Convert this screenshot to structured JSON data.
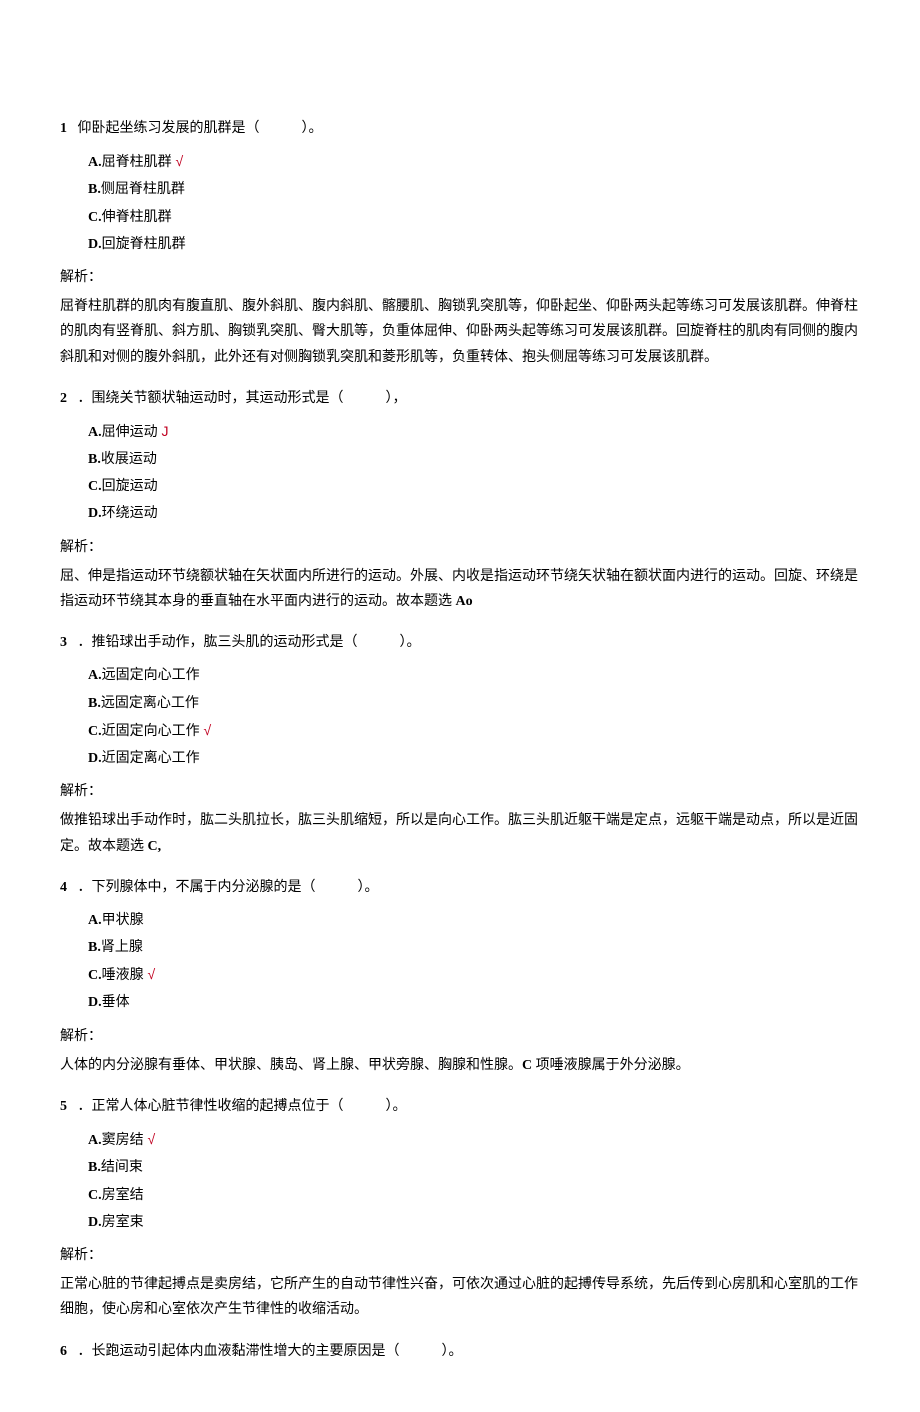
{
  "questions": [
    {
      "num": "1",
      "stem_before": "仰卧起坐练习发展的肌群是（",
      "stem_after": "）。",
      "options": [
        {
          "letter": "A.",
          "text": "屈脊柱肌群",
          "correct": true
        },
        {
          "letter": "B.",
          "text": "侧屈脊柱肌群",
          "correct": false
        },
        {
          "letter": "C.",
          "text": "伸脊柱肌群",
          "correct": false
        },
        {
          "letter": "D.",
          "text": "回旋脊柱肌群",
          "correct": false
        }
      ],
      "jx_label": "解析：",
      "explanation": "屈脊柱肌群的肌肉有腹直肌、腹外斜肌、腹内斜肌、髂腰肌、胸锁乳突肌等，仰卧起坐、仰卧两头起等练习可发展该肌群。伸脊柱的肌肉有竖脊肌、斜方肌、胸锁乳突肌、臀大肌等，负重体屈伸、仰卧两头起等练习可发展该肌群。回旋脊柱的肌肉有同侧的腹内斜肌和对侧的腹外斜肌，此外还有对侧胸锁乳突肌和菱形肌等，负重转体、抱头侧屈等练习可发展该肌群。"
    },
    {
      "num": "2",
      "stem_before": "．围绕关节额状轴运动时，其运动形式是（",
      "stem_after": "），",
      "options": [
        {
          "letter": "A.",
          "text": "屈伸运动",
          "correct": true,
          "mark": "J"
        },
        {
          "letter": "B.",
          "text": "收展运动",
          "correct": false
        },
        {
          "letter": "C.",
          "text": "回旋运动",
          "correct": false
        },
        {
          "letter": "D.",
          "text": "环绕运动",
          "correct": false
        }
      ],
      "jx_label": "解析：",
      "explanation_parts": [
        "屈、伸是指运动环节绕额状轴在矢状面内所进行的运动。外展、内收是指运动环节绕矢状轴在额状面内进行的运动。回旋、环绕是指运动环节绕其本身的垂直轴在水平面内进行的运动。故本题选",
        " Ao"
      ]
    },
    {
      "num": "3",
      "stem_before": "．推铅球出手动作，肱三头肌的运动形式是（",
      "stem_after": "）。",
      "options": [
        {
          "letter": "A.",
          "text": "远固定向心工作",
          "correct": false
        },
        {
          "letter": "B.",
          "text": "远固定离心工作",
          "correct": false
        },
        {
          "letter": "C.",
          "text": "近固定向心工作",
          "correct": true
        },
        {
          "letter": "D.",
          "text": "近固定离心工作",
          "correct": false
        }
      ],
      "jx_label": "解析：",
      "explanation_parts": [
        "做推铅球出手动作时，肱二头肌拉长，肱三头肌缩短，所以是向心工作。肱三头肌近躯干端是定点，远躯干端是动点，所以是近固定。故本题选",
        " C,"
      ]
    },
    {
      "num": "4",
      "stem_before": "．下列腺体中，不属于内分泌腺的是（",
      "stem_after": "）。",
      "options": [
        {
          "letter": "A.",
          "text": "甲状腺",
          "correct": false
        },
        {
          "letter": "B.",
          "text": "肾上腺",
          "correct": false
        },
        {
          "letter": "C.",
          "text": "唾液腺",
          "correct": true
        },
        {
          "letter": "D.",
          "text": "垂体",
          "correct": false
        }
      ],
      "jx_label": "解析：",
      "explanation_parts": [
        "人体的内分泌腺有垂体、甲状腺、胰岛、肾上腺、甲状旁腺、胸腺和性腺。",
        "C",
        " 项唾液腺属于外分泌腺。"
      ]
    },
    {
      "num": "5",
      "stem_before": "．正常人体心脏节律性收缩的起搏点位于（",
      "stem_after": "）。",
      "options": [
        {
          "letter": "A.",
          "text": "窦房结",
          "correct": true
        },
        {
          "letter": "B.",
          "text": "结间束",
          "correct": false
        },
        {
          "letter": "C.",
          "text": "房室结",
          "correct": false
        },
        {
          "letter": "D.",
          "text": "房室束",
          "correct": false
        }
      ],
      "jx_label": "解析：",
      "explanation": "正常心脏的节律起搏点是卖房结，它所产生的自动节律性兴奋，可依次通过心脏的起搏传导系统，先后传到心房肌和心室肌的工作细胞，使心房和心室依次产生节律性的收缩活动。"
    },
    {
      "num": "6",
      "stem_before": "．长跑运动引起体内血液黏滞性增大的主要原因是（",
      "stem_after": "）。",
      "options": [],
      "jx_label": "",
      "explanation": ""
    }
  ],
  "check_mark": "√"
}
